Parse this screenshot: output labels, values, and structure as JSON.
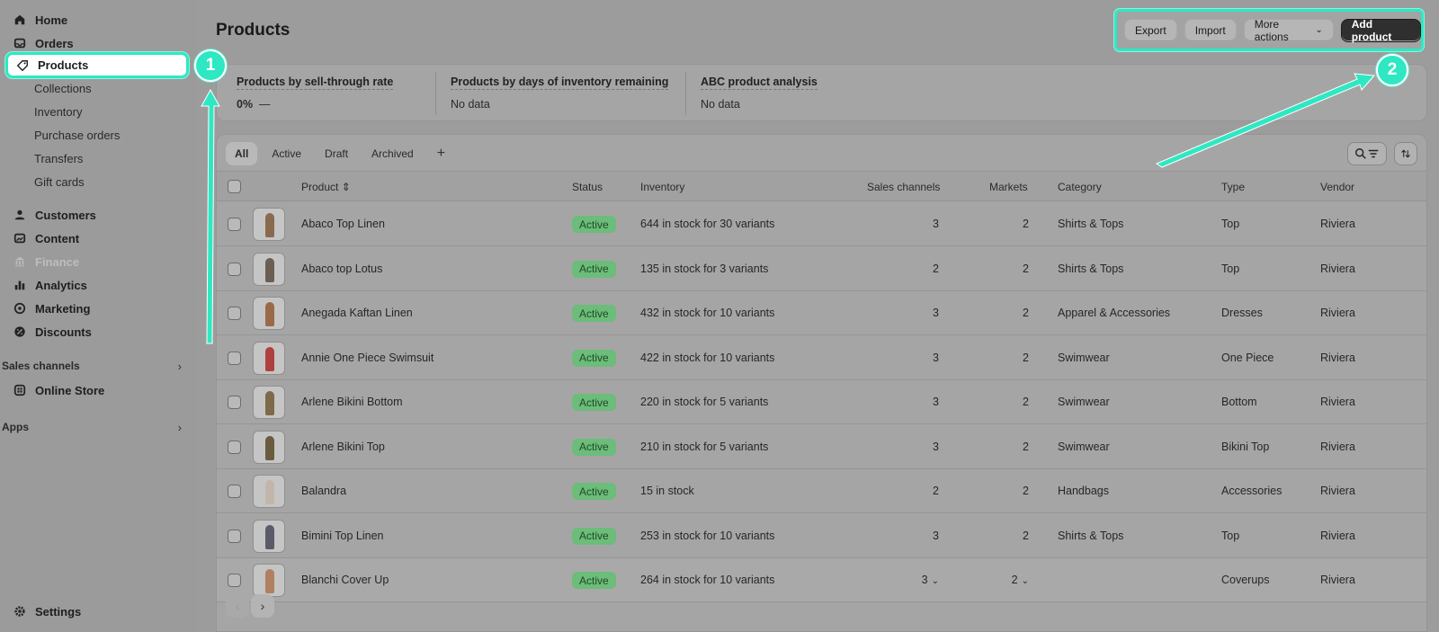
{
  "sidebar": {
    "items": [
      {
        "label": "Home",
        "icon": "home-icon"
      },
      {
        "label": "Orders",
        "icon": "inbox-icon"
      },
      {
        "label": "Products",
        "icon": "tag-icon"
      },
      {
        "label": "Customers",
        "icon": "person-icon"
      },
      {
        "label": "Content",
        "icon": "image-icon"
      },
      {
        "label": "Finance",
        "icon": "bank-icon"
      },
      {
        "label": "Analytics",
        "icon": "bar-chart-icon"
      },
      {
        "label": "Marketing",
        "icon": "target-icon"
      },
      {
        "label": "Discounts",
        "icon": "discount-icon"
      },
      {
        "label": "Online Store",
        "icon": "store-icon"
      },
      {
        "label": "Settings",
        "icon": "gear-icon"
      }
    ],
    "product_sub": [
      "Collections",
      "Inventory",
      "Purchase orders",
      "Transfers",
      "Gift cards"
    ],
    "sections": {
      "sales_channels": "Sales channels",
      "apps": "Apps"
    }
  },
  "header": {
    "title": "Products",
    "export": "Export",
    "import": "Import",
    "more_actions": "More actions",
    "add_product": "Add product"
  },
  "analytics": [
    {
      "title": "Products by sell-through rate",
      "value": "0%",
      "value_suffix": "—"
    },
    {
      "title": "Products by days of inventory remaining",
      "value": "No data"
    },
    {
      "title": "ABC product analysis",
      "value": "No data"
    }
  ],
  "tabs": [
    "All",
    "Active",
    "Draft",
    "Archived",
    "+"
  ],
  "columns": [
    "Product",
    "Status",
    "Inventory",
    "Sales channels",
    "Markets",
    "Category",
    "Type",
    "Vendor"
  ],
  "rows": [
    {
      "product": "Abaco Top Linen",
      "status": "Active",
      "inventory": "644 in stock for 30 variants",
      "channels": "3",
      "markets": "2",
      "category": "Shirts & Tops",
      "type": "Top",
      "vendor": "Riviera"
    },
    {
      "product": "Abaco top Lotus",
      "status": "Active",
      "inventory": "135 in stock for 3 variants",
      "channels": "2",
      "markets": "2",
      "category": "Shirts & Tops",
      "type": "Top",
      "vendor": "Riviera"
    },
    {
      "product": "Anegada Kaftan Linen",
      "status": "Active",
      "inventory": "432 in stock for 10 variants",
      "channels": "3",
      "markets": "2",
      "category": "Apparel & Accessories",
      "type": "Dresses",
      "vendor": "Riviera"
    },
    {
      "product": "Annie One Piece Swimsuit",
      "status": "Active",
      "inventory": "422 in stock for 10 variants",
      "channels": "3",
      "markets": "2",
      "category": "Swimwear",
      "type": "One Piece",
      "vendor": "Riviera"
    },
    {
      "product": "Arlene Bikini Bottom",
      "status": "Active",
      "inventory": "220 in stock for 5 variants",
      "channels": "3",
      "markets": "2",
      "category": "Swimwear",
      "type": "Bottom",
      "vendor": "Riviera"
    },
    {
      "product": "Arlene Bikini Top",
      "status": "Active",
      "inventory": "210 in stock for 5 variants",
      "channels": "3",
      "markets": "2",
      "category": "Swimwear",
      "type": "Bikini Top",
      "vendor": "Riviera"
    },
    {
      "product": "Balandra",
      "status": "Active",
      "inventory": "15 in stock",
      "channels": "2",
      "markets": "2",
      "category": "Handbags",
      "type": "Accessories",
      "vendor": "Riviera"
    },
    {
      "product": "Bimini Top Linen",
      "status": "Active",
      "inventory": "253 in stock for 10 variants",
      "channels": "3",
      "markets": "2",
      "category": "Shirts & Tops",
      "type": "Top",
      "vendor": "Riviera"
    },
    {
      "product": "Blanchi Cover Up",
      "status": "Active",
      "inventory": "264 in stock for 10 variants",
      "channels": "3",
      "markets": "2",
      "category": "",
      "type": "Coverups",
      "vendor": "Riviera"
    }
  ],
  "annotations": [
    "1",
    "2"
  ],
  "colors": {
    "accent": "#2ee8c3",
    "badge": "#6cbc7a",
    "primary_button": "#2f2f2f"
  }
}
